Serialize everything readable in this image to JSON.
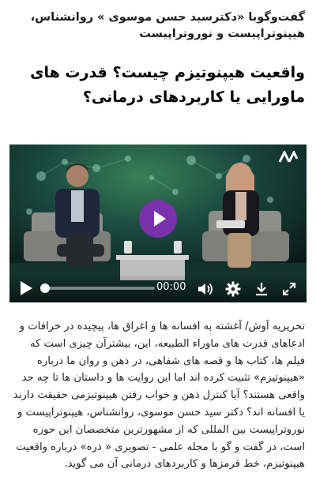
{
  "article": {
    "kicker": "گفت‌وگوبا «دکترسید حسن موسوی » روانشناس، هیپنوتراپیست و نوروتراپیست",
    "headline": "واقعیت هیپنوتیزم چیست؟ قدرت های ماورایی یا کاربردهای درمانی؟",
    "body": "تحریریه آوش/ آغشته به افسانه ها و اغراق ها، پیچیده در خرافات و ادعاهای قدرت های ماوراء الطبیعه، این، بیشترآن چیزی است که فیلم ها، کتاب ها و قصه های شفاهی، در ذهن و روان ما درباره «هیپنوتیزم» تثبیت کرده اند اما این روایت ها و داستان ها تا چه حد واقعی هستند؟ آیا کنترل ذهن و خواب رفتن هیپنوتیزمی حقیقت دارند یا افسانه اند؟ دکتر سید حسن موسوی، روانشناس، هیپنوتراپیست و نوروتراپیست بین المللی که از مشهورترین متخصصان این حوزه است، در گفت و گو با مجله علمی - تصویری « ذره» درباره واقعیت هیپنوتیزم، خط قرمزها و کاربردهای درمانی آن می گوید."
  },
  "video_player": {
    "current_time": "00:00",
    "progress": 0,
    "accent_color": "#7a32aa",
    "controls": [
      "play-icon",
      "volume-icon",
      "gear-icon",
      "download-icon",
      "fullscreen-icon"
    ]
  }
}
